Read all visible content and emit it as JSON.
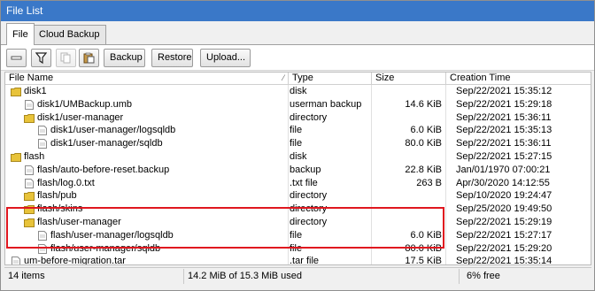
{
  "window": {
    "title": "File List"
  },
  "tabs": [
    {
      "label": "File",
      "active": true
    },
    {
      "label": "Cloud Backup",
      "active": false
    }
  ],
  "toolbar": {
    "icons": [
      "minus-icon",
      "filter-icon",
      "copy-icon",
      "paste-icon"
    ],
    "backup_label": "Backup",
    "restore_label": "Restore",
    "upload_label": "Upload..."
  },
  "columns": {
    "name": "File Name",
    "type": "Type",
    "size": "Size",
    "created": "Creation Time"
  },
  "rows": [
    {
      "name": "disk1",
      "icon": "folder-icon",
      "indent": 0,
      "type": "disk",
      "size": "",
      "created": "Sep/22/2021 15:35:12"
    },
    {
      "name": "disk1/UMBackup.umb",
      "icon": "file-icon",
      "indent": 1,
      "type": "userman backup",
      "size": "14.6 KiB",
      "created": "Sep/22/2021 15:29:18"
    },
    {
      "name": "disk1/user-manager",
      "icon": "folder-icon",
      "indent": 1,
      "type": "directory",
      "size": "",
      "created": "Sep/22/2021 15:36:11"
    },
    {
      "name": "disk1/user-manager/logsqldb",
      "icon": "file-icon",
      "indent": 2,
      "type": "file",
      "size": "6.0 KiB",
      "created": "Sep/22/2021 15:35:13"
    },
    {
      "name": "disk1/user-manager/sqldb",
      "icon": "file-icon",
      "indent": 2,
      "type": "file",
      "size": "80.0 KiB",
      "created": "Sep/22/2021 15:36:11"
    },
    {
      "name": "flash",
      "icon": "folder-icon",
      "indent": 0,
      "type": "disk",
      "size": "",
      "created": "Sep/22/2021 15:27:15"
    },
    {
      "name": "flash/auto-before-reset.backup",
      "icon": "file-icon",
      "indent": 1,
      "type": "backup",
      "size": "22.8 KiB",
      "created": "Jan/01/1970 07:00:21"
    },
    {
      "name": "flash/log.0.txt",
      "icon": "file-icon",
      "indent": 1,
      "type": ".txt file",
      "size": "263 B",
      "created": "Apr/30/2020 14:12:55"
    },
    {
      "name": "flash/pub",
      "icon": "folder-icon",
      "indent": 1,
      "type": "directory",
      "size": "",
      "created": "Sep/10/2020 19:24:47"
    },
    {
      "name": "flash/skins",
      "icon": "folder-icon",
      "indent": 1,
      "type": "directory",
      "size": "",
      "created": "Sep/25/2020 19:49:50"
    },
    {
      "name": "flash/user-manager",
      "icon": "folder-icon",
      "indent": 1,
      "type": "directory",
      "size": "",
      "created": "Sep/22/2021 15:29:19"
    },
    {
      "name": "flash/user-manager/logsqldb",
      "icon": "file-icon",
      "indent": 2,
      "type": "file",
      "size": "6.0 KiB",
      "created": "Sep/22/2021 15:27:17"
    },
    {
      "name": "flash/user-manager/sqldb",
      "icon": "file-icon",
      "indent": 2,
      "type": "file",
      "size": "80.0 KiB",
      "created": "Sep/22/2021 15:29:20"
    },
    {
      "name": "um-before-migration.tar",
      "icon": "file-icon",
      "indent": 0,
      "type": ".tar file",
      "size": "17.5 KiB",
      "created": "Sep/22/2021 15:35:14"
    }
  ],
  "status": {
    "count": "14 items",
    "usage": "14.2 MiB of 15.3 MiB used",
    "free": "6% free"
  },
  "colors": {
    "titlebar": "#3a78c8",
    "folder": "#e8c33a",
    "highlight": "#e0171f"
  }
}
